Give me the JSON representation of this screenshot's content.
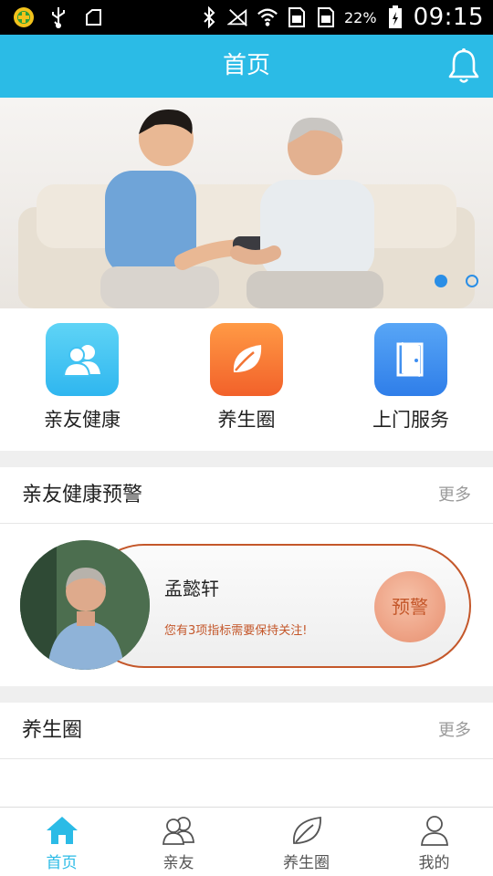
{
  "status_bar": {
    "battery_percent": "22%",
    "time": "09:15",
    "icons": [
      "app-icon",
      "usb-icon",
      "clipboard-icon",
      "bluetooth-icon",
      "no-sim-signal-icon",
      "wifi-icon",
      "sim-card-icon",
      "sim-card-icon",
      "battery-charging-icon"
    ]
  },
  "header": {
    "title": "首页",
    "bell_icon": "bell-icon"
  },
  "banner": {
    "slide_count": 2,
    "active_slide": 1
  },
  "quick_actions": [
    {
      "label": "亲友健康",
      "icon": "people-icon",
      "color": "#3fc2f2"
    },
    {
      "label": "养生圈",
      "icon": "leaf-icon",
      "color": "#fb7a33"
    },
    {
      "label": "上门服务",
      "icon": "door-icon",
      "color": "#3d8ff2"
    }
  ],
  "health_alert_section": {
    "title": "亲友健康预警",
    "more": "更多",
    "card": {
      "name": "孟懿轩",
      "message": "您有3项指标需要保持关注!",
      "button": "预警"
    }
  },
  "wellness_section": {
    "title": "养生圈",
    "more": "更多"
  },
  "bottom_nav": [
    {
      "label": "首页",
      "icon": "home-icon",
      "active": true
    },
    {
      "label": "亲友",
      "icon": "friends-icon",
      "active": false
    },
    {
      "label": "养生圈",
      "icon": "leaf-icon",
      "active": false
    },
    {
      "label": "我的",
      "icon": "person-icon",
      "active": false
    }
  ],
  "colors": {
    "primary": "#2bbbe6",
    "alert": "#c4572a",
    "indicator": "#2a8ee6"
  }
}
